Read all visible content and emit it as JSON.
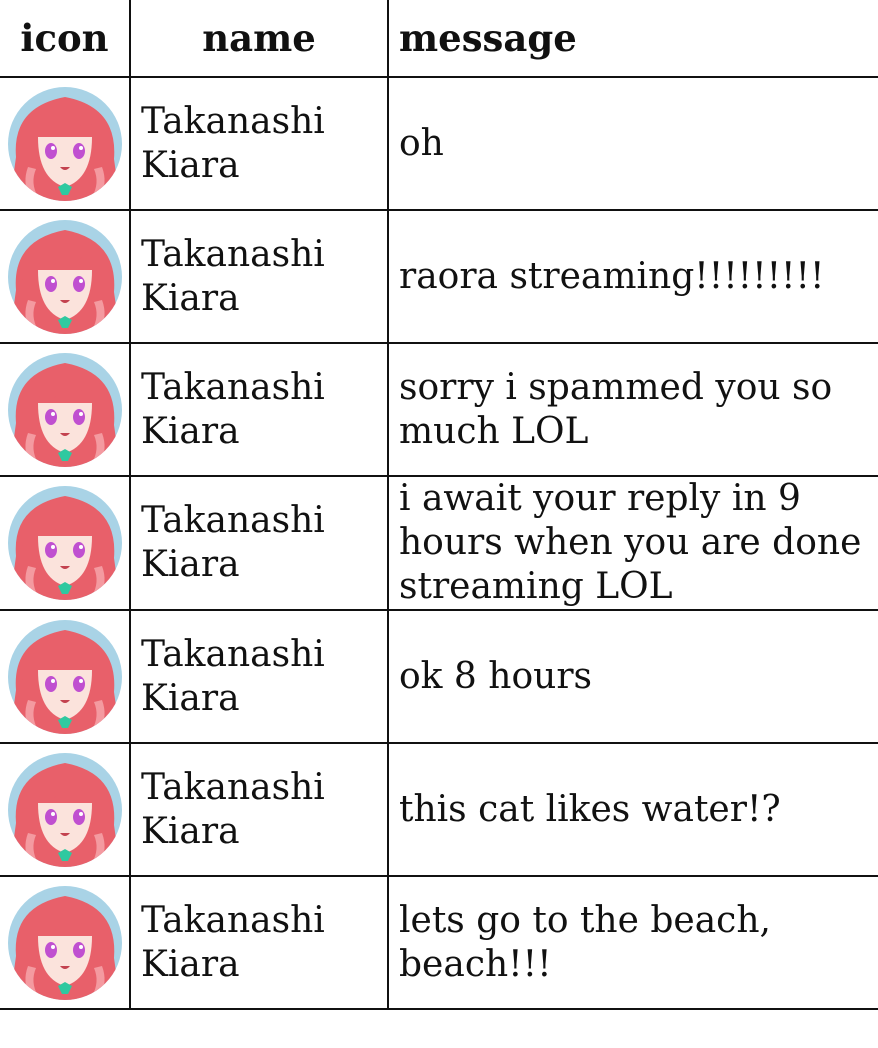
{
  "headers": {
    "icon": "icon",
    "name": "name",
    "message": "message"
  },
  "rows": [
    {
      "avatar": "anime-avatar-icon",
      "first_name": "Takanashi",
      "last_name": "Kiara",
      "message": "oh"
    },
    {
      "avatar": "anime-avatar-icon",
      "first_name": "Takanashi",
      "last_name": "Kiara",
      "message": "raora streaming!!!!!!!!!"
    },
    {
      "avatar": "anime-avatar-icon",
      "first_name": "Takanashi",
      "last_name": "Kiara",
      "message": "sorry i spammed you so much LOL"
    },
    {
      "avatar": "anime-avatar-icon",
      "first_name": "Takanashi",
      "last_name": "Kiara",
      "message": "i await your reply in 9 hours when you are done streaming LOL"
    },
    {
      "avatar": "anime-avatar-icon",
      "first_name": "Takanashi",
      "last_name": "Kiara",
      "message": "ok 8 hours"
    },
    {
      "avatar": "anime-avatar-icon",
      "first_name": "Takanashi",
      "last_name": "Kiara",
      "message": "this cat likes water!?"
    },
    {
      "avatar": "anime-avatar-icon",
      "first_name": "Takanashi",
      "last_name": "Kiara",
      "message": "lets go to the beach, beach!!!"
    }
  ],
  "colors": {
    "hair": "#e8606a",
    "hair_light": "#f49aa0",
    "skin": "#fbe3dc",
    "eyes": "#c04fd0",
    "ribbon": "#2fc9a0",
    "background": "#a9d3e6",
    "border": "#111111"
  }
}
